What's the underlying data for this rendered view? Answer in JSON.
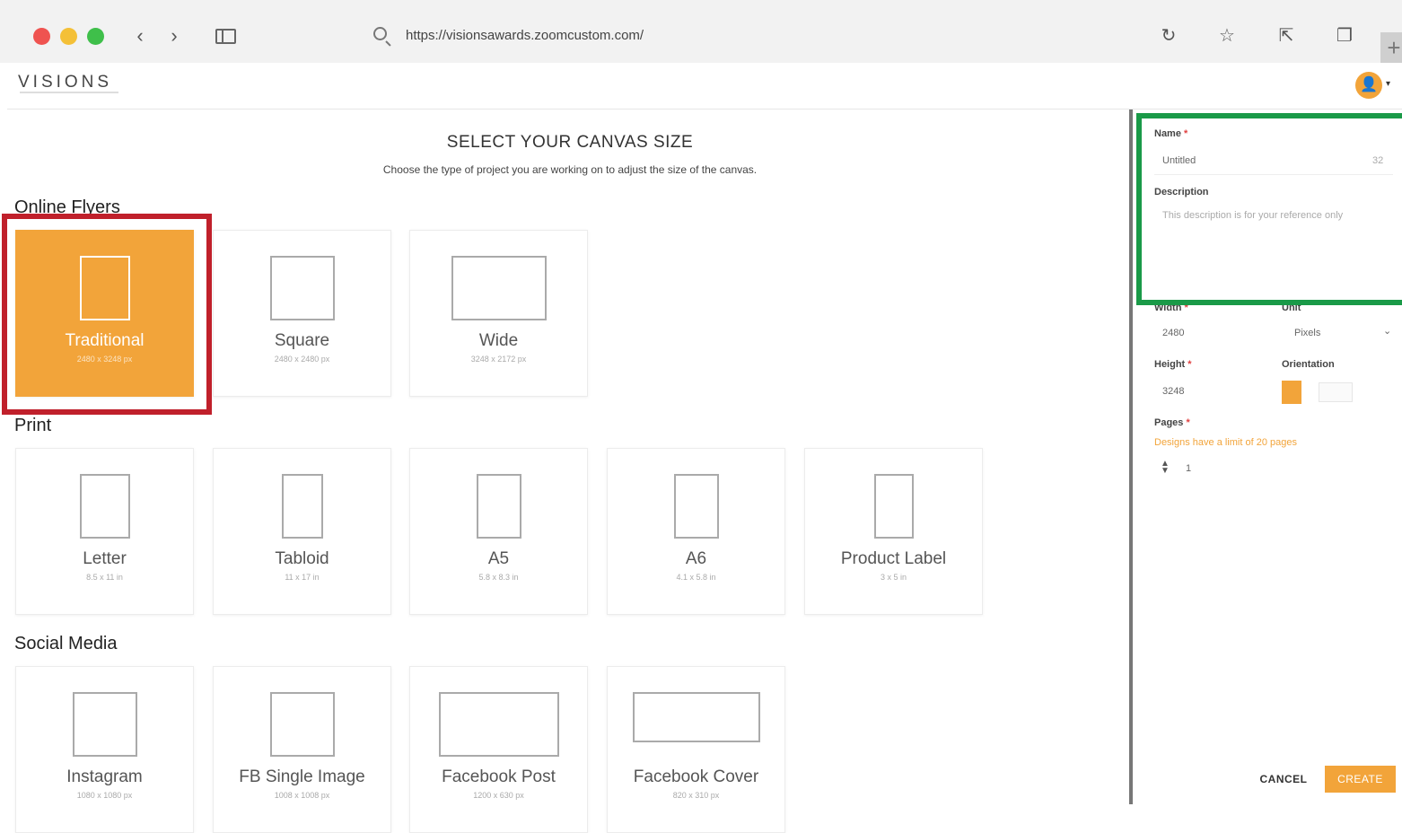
{
  "browser": {
    "url": "https://visionsawards.zoomcustom.com/",
    "back_glyph": "‹",
    "forward_glyph": "›",
    "reload_glyph": "↻",
    "bookmark_glyph": "☆",
    "share_glyph": "⇱",
    "tabs_glyph": "❐",
    "new_tab_glyph": "+",
    "icons": [
      "search-icon",
      "reload-icon",
      "bookmark-star-icon",
      "share-icon",
      "tabs-icon",
      "plus-icon"
    ]
  },
  "header": {
    "logo": "VISIONS",
    "avatar_glyph": "👤",
    "caret_glyph": "▾"
  },
  "main": {
    "title": "SELECT YOUR CANVAS SIZE",
    "subtitle": "Choose the type of project you are working on to adjust the size of the canvas."
  },
  "sections": {
    "online_flyers": {
      "title": "Online Flyers",
      "cards": [
        {
          "name": "Traditional",
          "size": "2480 x 3248 px",
          "selected": true
        },
        {
          "name": "Square",
          "size": "2480 x 2480 px"
        },
        {
          "name": "Wide",
          "size": "3248 x 2172 px"
        }
      ]
    },
    "print": {
      "title": "Print",
      "cards": [
        {
          "name": "Letter",
          "size": "8.5 x 11 in"
        },
        {
          "name": "Tabloid",
          "size": "11 x 17 in"
        },
        {
          "name": "A5",
          "size": "5.8 x 8.3 in"
        },
        {
          "name": "A6",
          "size": "4.1 x 5.8 in"
        },
        {
          "name": "Product Label",
          "size": "3 x 5 in"
        }
      ]
    },
    "social_media": {
      "title": "Social Media",
      "cards": [
        {
          "name": "Instagram",
          "size": "1080 x 1080 px"
        },
        {
          "name": "FB Single Image",
          "size": "1008 x 1008 px"
        },
        {
          "name": "Facebook Post",
          "size": "1200 x 630 px"
        },
        {
          "name": "Facebook Cover",
          "size": "820 x 310 px"
        }
      ]
    }
  },
  "panel": {
    "name_label": "Name",
    "required_mark": "*",
    "name_value": "Untitled",
    "name_counter": "32",
    "description_label": "Description",
    "description_placeholder": "This description is for your reference only",
    "width_label": "Width",
    "width_value": "2480",
    "unit_label": "Unit",
    "unit_value": "Pixels",
    "unit_caret": "⌄",
    "height_label": "Height",
    "height_value": "3248",
    "orientation_label": "Orientation",
    "pages_label": "Pages",
    "pages_hint": "Designs have a limit of 20 pages",
    "pages_value": "1",
    "stepper_up": "▲",
    "stepper_down": "▼",
    "cancel_label": "CANCEL",
    "create_label": "CREATE"
  },
  "colors": {
    "accent": "#f2a43a",
    "highlight_red": "#c0202b",
    "highlight_green": "#1a9a48"
  }
}
